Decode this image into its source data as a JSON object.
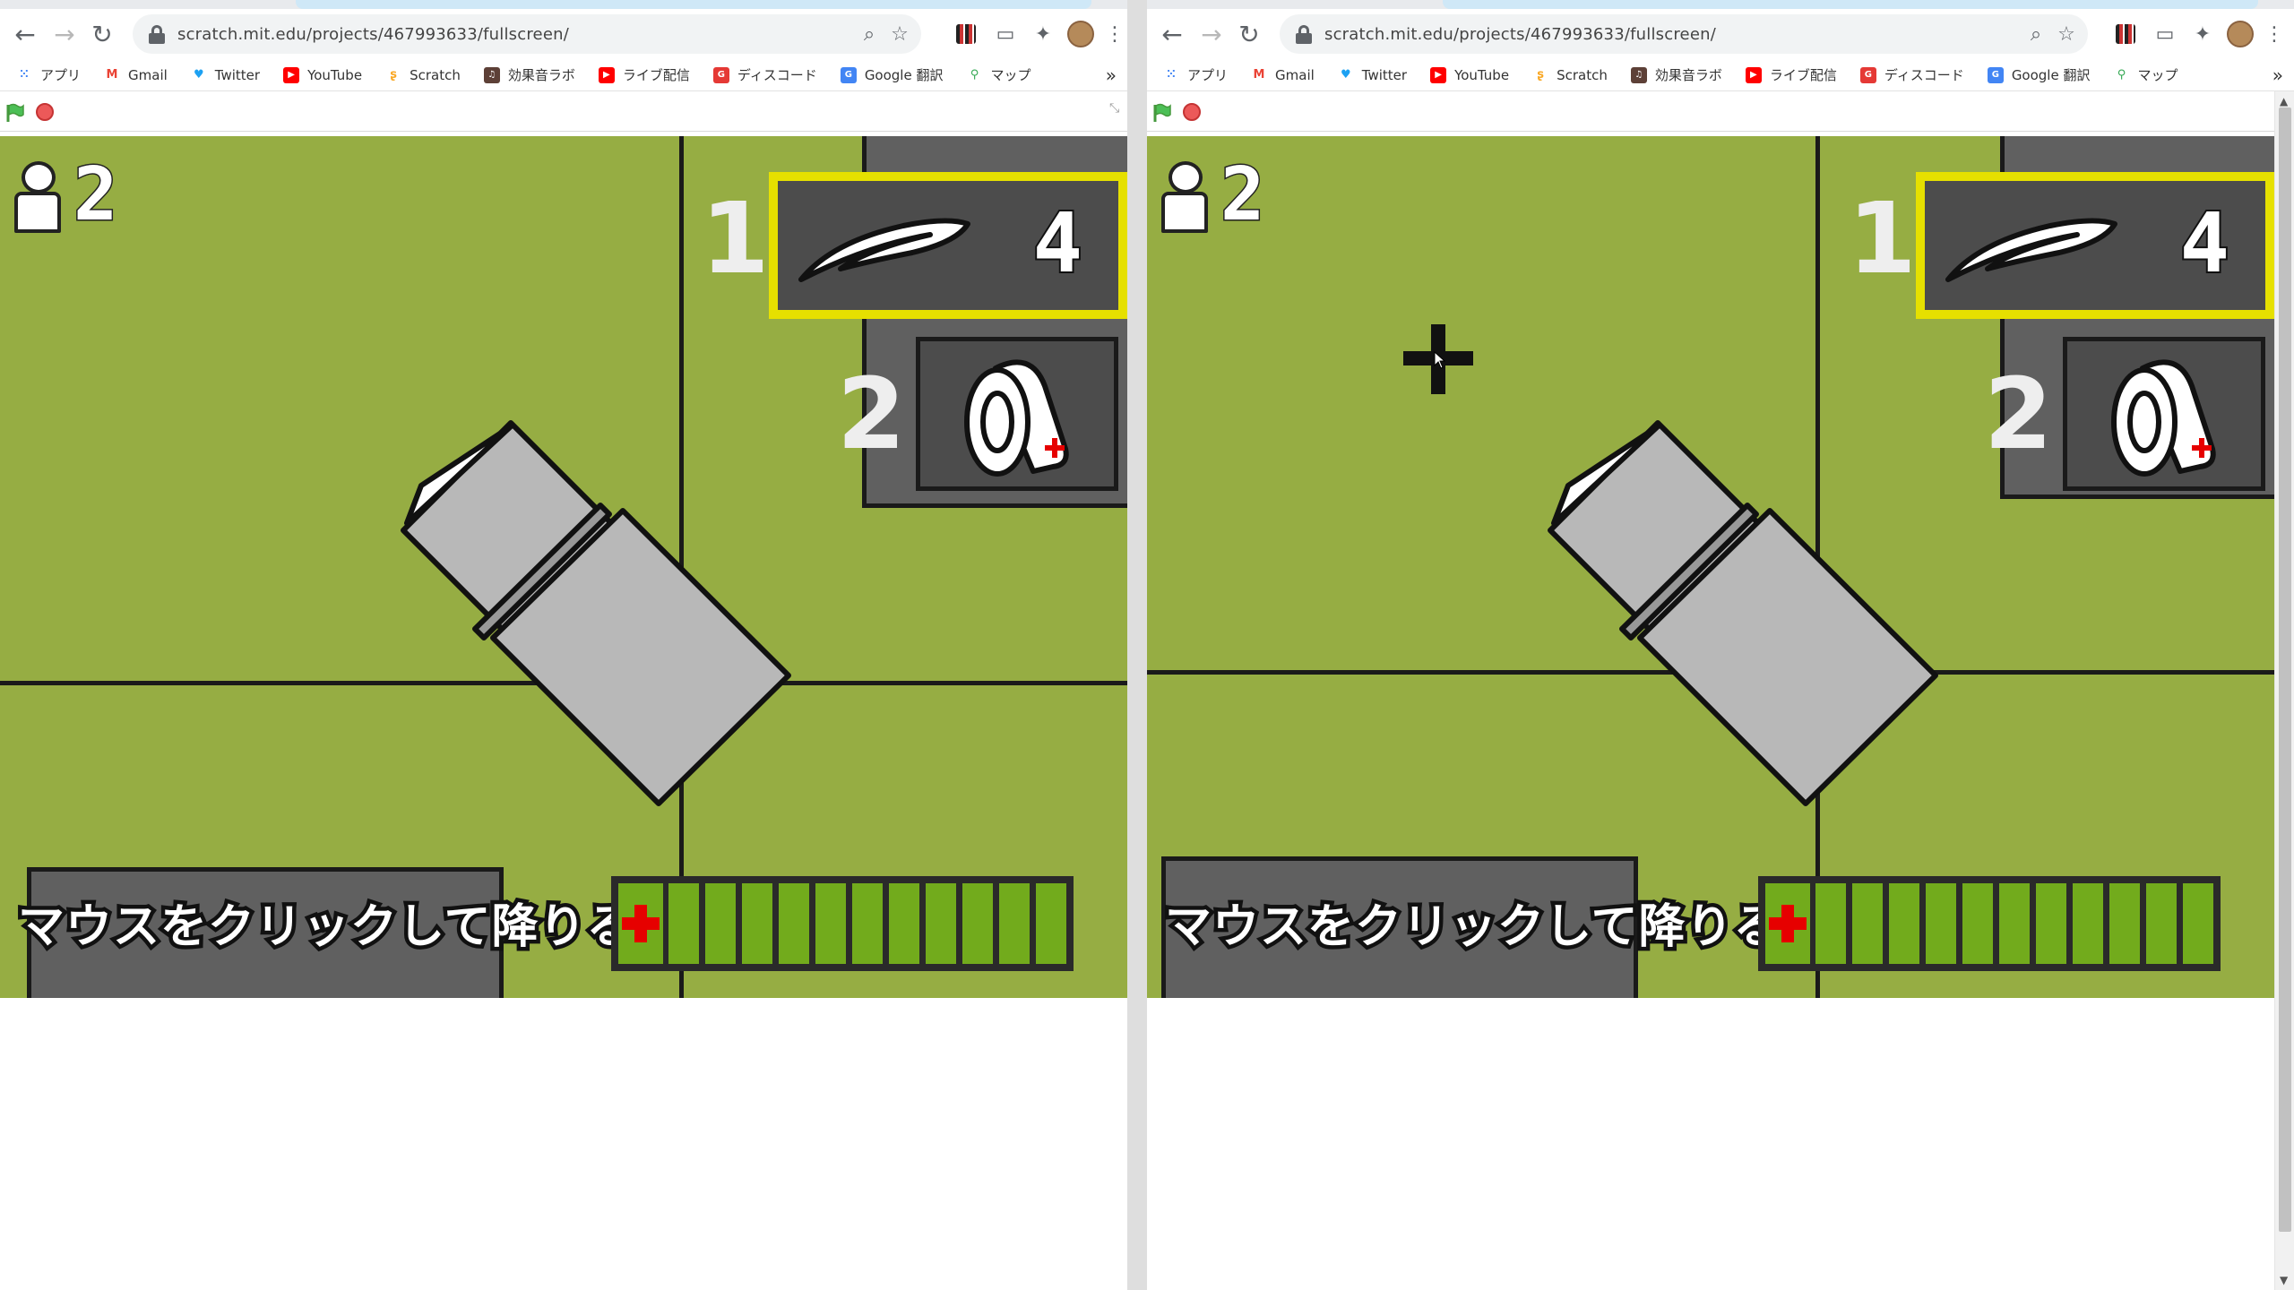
{
  "browser": {
    "url": "scratch.mit.edu/projects/467993633/fullscreen/",
    "bookmarks": [
      {
        "label": "アプリ",
        "icon": "apps-grid-icon",
        "color": "#4285f4"
      },
      {
        "label": "Gmail",
        "icon": "gmail-icon",
        "color": "#ea4335"
      },
      {
        "label": "Twitter",
        "icon": "twitter-icon",
        "color": "#1da1f2"
      },
      {
        "label": "YouTube",
        "icon": "youtube-icon",
        "color": "#ff0000"
      },
      {
        "label": "Scratch",
        "icon": "scratch-icon",
        "color": "#f9a825"
      },
      {
        "label": "効果音ラボ",
        "icon": "sound-lab-icon",
        "color": "#5d4037"
      },
      {
        "label": "ライブ配信",
        "icon": "youtube-icon",
        "color": "#ff0000"
      },
      {
        "label": "ディスコード",
        "icon": "discord-icon",
        "color": "#e53935"
      },
      {
        "label": "Google 翻訳",
        "icon": "google-translate-icon",
        "color": "#4285f4"
      },
      {
        "label": "マップ",
        "icon": "maps-pin-icon",
        "color": "#34a853"
      }
    ],
    "more_bookmarks": "»"
  },
  "game": {
    "player_count": "2",
    "slots": [
      {
        "number": "1",
        "item": "feather",
        "count": "4",
        "selected": true
      },
      {
        "number": "2",
        "item": "bandage-roll",
        "count": "",
        "selected": false
      }
    ],
    "caption": "マウスをクリックして降りる",
    "health": {
      "segments_total": 12,
      "segments_filled": 12
    },
    "colors": {
      "grass": "#96ad43",
      "road": "#606060",
      "selection": "#e6e000",
      "health": "#72ab1c",
      "cross": "#e60000"
    }
  }
}
